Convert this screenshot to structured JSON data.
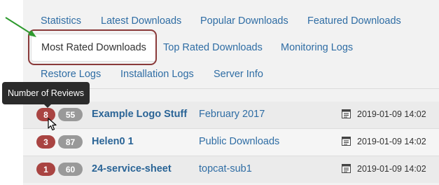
{
  "colors": {
    "link": "#2f6da4",
    "badge_rating": "#a94442",
    "badge_reviews": "#999999",
    "highlight_border": "#8a3a3a",
    "annotation_arrow": "#2e9a2e"
  },
  "nav": {
    "tabs": [
      {
        "label": "Statistics"
      },
      {
        "label": "Latest Downloads"
      },
      {
        "label": "Popular Downloads"
      },
      {
        "label": "Featured Downloads"
      },
      {
        "label": "Most Rated Downloads",
        "active": true
      },
      {
        "label": "Top Rated Downloads"
      },
      {
        "label": "Monitoring Logs"
      },
      {
        "label": "Restore Logs"
      },
      {
        "label": "Installation Logs"
      },
      {
        "label": "Server Info"
      }
    ]
  },
  "tooltip": {
    "text": "Number of Reviews"
  },
  "rows": [
    {
      "rating": "8",
      "reviews": "55",
      "title": "Example Logo Stuff",
      "category": "February 2017",
      "date": "2019-01-09 14:02"
    },
    {
      "rating": "3",
      "reviews": "87",
      "title": "Helen0 1",
      "category": "Public Downloads",
      "date": "2019-01-09 14:02"
    },
    {
      "rating": "1",
      "reviews": "60",
      "title": "24-service-sheet",
      "category": "topcat-sub1",
      "date": "2019-01-09 14:02"
    }
  ],
  "icons": {
    "date": "calendar-icon",
    "cursor": "mouse-pointer-icon",
    "annotation": "green-arrow-icon"
  }
}
